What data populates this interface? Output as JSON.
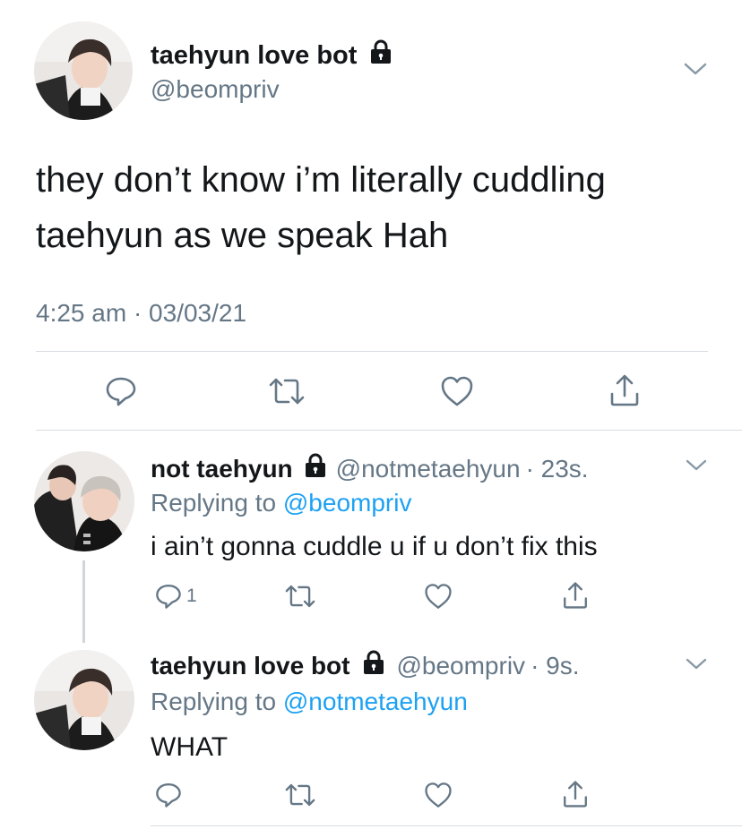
{
  "main_tweet": {
    "display_name": "taehyun love bot",
    "handle": "@beompriv",
    "text_line1": "they don’t know i’m literally cuddling",
    "text_line2": "taehyun as we speak Hah",
    "timestamp": "4:25 am · 03/03/21"
  },
  "replies": [
    {
      "display_name": "not taehyun",
      "handle": "@notmetaehyun",
      "time": "· 23s.",
      "replying_prefix": "Replying to ",
      "replying_to": "@beompriv",
      "text": "i ain’t gonna cuddle u if u don’t fix this",
      "reply_count": "1"
    },
    {
      "display_name": "taehyun love bot",
      "handle": "@beompriv",
      "time": "· 9s.",
      "replying_prefix": "Replying to ",
      "replying_to": "@notmetaehyun",
      "text": "WHAT",
      "reply_count": ""
    }
  ],
  "icons": {
    "lock": "lock-icon",
    "chevron": "chevron-down-icon",
    "reply": "reply-icon",
    "retweet": "retweet-icon",
    "like": "like-icon",
    "share": "share-icon"
  },
  "colors": {
    "text": "#14171a",
    "muted": "#657786",
    "link": "#1da1f2",
    "divider": "#d8dde2"
  }
}
